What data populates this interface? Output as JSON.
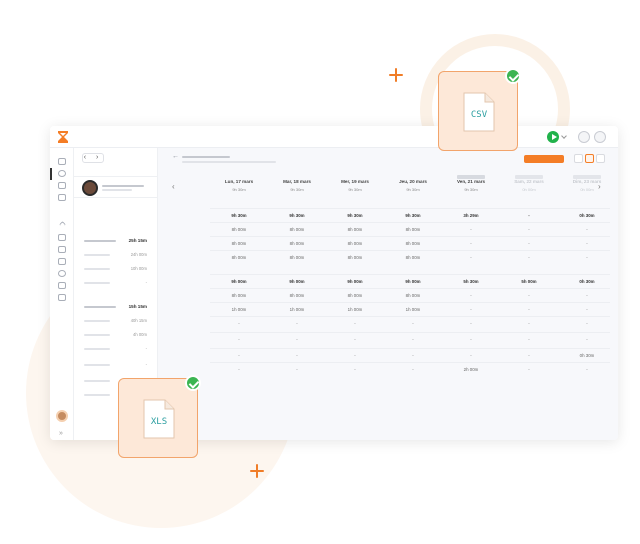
{
  "colors": {
    "accent": "#f47d26",
    "play": "#21b24b",
    "check": "#3cb552",
    "doc_text": "#2b9ea0"
  },
  "icons": {
    "logo": "hourglass-logo",
    "header": [
      "timer-icon",
      "chart-icon"
    ],
    "nav": [
      "grid-icon",
      "clock-icon",
      "calendar-icon",
      "team-icon",
      "chevron-up-icon",
      "building-icon",
      "folder-icon",
      "briefcase-icon",
      "pin-icon",
      "tag-icon",
      "people-icon"
    ]
  },
  "left_panel": {
    "nav_arrows": "‹ ›"
  },
  "main": {
    "back": "←",
    "prev": "‹",
    "next": "›"
  },
  "days": [
    {
      "name": "Lun, 17 mars",
      "sub": "9h 30m",
      "faded": false
    },
    {
      "name": "Mar, 18 mars",
      "sub": "9h 30m",
      "faded": false
    },
    {
      "name": "Mer, 19 mars",
      "sub": "9h 30m",
      "faded": false
    },
    {
      "name": "Jeu, 20 mars",
      "sub": "9h 30m",
      "faded": false
    },
    {
      "name": "Ven, 21 mars",
      "sub": "9h 30m",
      "faded": false
    },
    {
      "name": "Sam, 22 mars",
      "sub": "0h 00m",
      "faded": true
    },
    {
      "name": "Dim, 23 mars",
      "sub": "0h 00m",
      "faded": true
    }
  ],
  "left_rows": [
    {
      "value": "25h 15m",
      "type": "total"
    },
    {
      "value": "24h 00m",
      "type": "sub"
    },
    {
      "value": "10h 00m",
      "type": "sub"
    },
    {
      "value": "-",
      "type": "sub"
    },
    {
      "value": "",
      "type": "gap"
    },
    {
      "value": "15h 15m",
      "type": "total"
    },
    {
      "value": "40h 15m",
      "type": "sub"
    },
    {
      "value": "4h 00m",
      "type": "sub"
    },
    {
      "value": "-",
      "type": "sub"
    },
    {
      "value": "-",
      "type": "sub"
    },
    {
      "value": "-",
      "type": "sub"
    },
    {
      "value": "-",
      "type": "sub"
    }
  ],
  "grid": [
    {
      "bold": true,
      "cells": [
        "9h 30m",
        "9h 30m",
        "9h 30m",
        "9h 30m",
        "3h 29m",
        "-",
        "0h 30m"
      ]
    },
    {
      "bold": false,
      "cells": [
        "8h 00m",
        "8h 00m",
        "8h 00m",
        "8h 00m",
        "-",
        "-",
        "-"
      ]
    },
    {
      "bold": false,
      "cells": [
        "8h 00m",
        "8h 00m",
        "8h 00m",
        "8h 00m",
        "-",
        "-",
        "-"
      ]
    },
    {
      "bold": false,
      "cells": [
        "8h 00m",
        "8h 00m",
        "8h 00m",
        "8h 00m",
        "-",
        "-",
        "-"
      ]
    },
    {
      "bold": false,
      "cells": [
        "",
        "",
        "",
        "",
        "",
        "",
        ""
      ]
    },
    {
      "bold": true,
      "cells": [
        "9h 00m",
        "9h 00m",
        "9h 00m",
        "9h 00m",
        "5h 30m",
        "5h 00m",
        "0h 30m"
      ]
    },
    {
      "bold": false,
      "cells": [
        "8h 00m",
        "8h 00m",
        "8h 00m",
        "8h 00m",
        "-",
        "-",
        "-"
      ]
    },
    {
      "bold": false,
      "cells": [
        "1h 00m",
        "1h 00m",
        "1h 00m",
        "1h 00m",
        "-",
        "-",
        "-"
      ]
    },
    {
      "bold": false,
      "cells": [
        "-",
        "-",
        "-",
        "-",
        "-",
        "-",
        "-"
      ]
    },
    {
      "bold": false,
      "cells": [
        "-",
        "-",
        "-",
        "-",
        "-",
        "-",
        "-"
      ]
    },
    {
      "bold": false,
      "cells": [
        "-",
        "-",
        "-",
        "-",
        "-",
        "-",
        "0h 30m"
      ]
    },
    {
      "bold": false,
      "cells": [
        "-",
        "-",
        "-",
        "-",
        "2h 00m",
        "-",
        "-"
      ]
    }
  ],
  "files": {
    "csv": "CSV",
    "xls": "XLS"
  }
}
